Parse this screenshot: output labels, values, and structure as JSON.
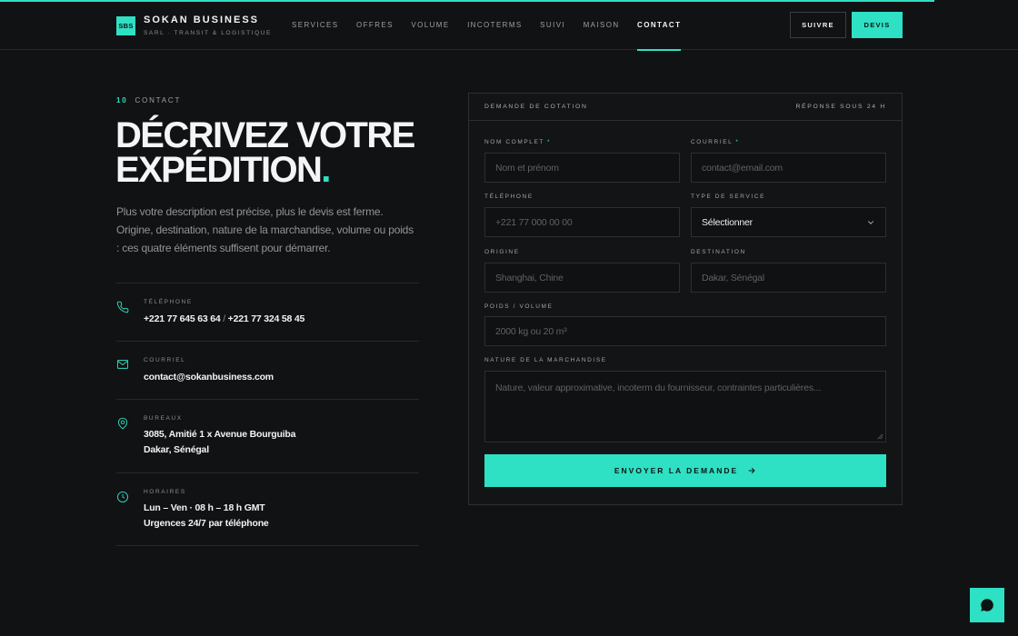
{
  "brand": {
    "logo": "SBS",
    "name": "SOKAN BUSINESS",
    "tagline": "SARL · TRANSIT & LOGISTIQUE"
  },
  "nav": [
    "SERVICES",
    "OFFRES",
    "VOLUME",
    "INCOTERMS",
    "SUIVI",
    "MAISON",
    "CONTACT"
  ],
  "nav_active": "CONTACT",
  "header_buttons": {
    "follow": "SUIVRE",
    "quote": "DEVIS"
  },
  "section": {
    "number": "10",
    "name": "CONTACT"
  },
  "headline": {
    "line1": "DÉCRIVEZ VOTRE",
    "line2": "EXPÉDITION",
    "dot": "."
  },
  "lead": "Plus votre description est précise, plus le devis est ferme. Origine, destination, nature de la marchandise, volume ou poids : ces quatre éléments suffisent pour démarrer.",
  "contact_info": {
    "phone": {
      "label": "TÉLÉPHONE",
      "value1": "+221 77 645 63 64",
      "separator": "/",
      "value2": "+221 77 324 58 45",
      "icon": "phone-icon"
    },
    "email": {
      "label": "COURRIEL",
      "value": "contact@sokanbusiness.com",
      "icon": "mail-icon"
    },
    "office": {
      "label": "BUREAUX",
      "line1": "3085, Amitié 1 x Avenue Bourguiba",
      "line2": "Dakar, Sénégal",
      "icon": "map-pin-icon"
    },
    "hours": {
      "label": "HORAIRES",
      "line1": "Lun – Ven · 08 h – 18 h GMT",
      "line2": "Urgences 24/7 par téléphone",
      "icon": "clock-icon"
    }
  },
  "form": {
    "title": "DEMANDE DE COTATION",
    "note": "RÉPONSE SOUS 24 H",
    "fields": {
      "name": {
        "label": "NOM COMPLET",
        "required": "*",
        "placeholder": "Nom et prénom"
      },
      "email": {
        "label": "COURRIEL",
        "required": "*",
        "placeholder": "contact@email.com"
      },
      "phone": {
        "label": "TÉLÉPHONE",
        "placeholder": "+221 77 000 00 00"
      },
      "service": {
        "label": "TYPE DE SERVICE",
        "value": "Sélectionner"
      },
      "origin": {
        "label": "ORIGINE",
        "placeholder": "Shanghai, Chine"
      },
      "destination": {
        "label": "DESTINATION",
        "placeholder": "Dakar, Sénégal"
      },
      "weight": {
        "label": "POIDS / VOLUME",
        "placeholder": "2000 kg ou 20 m³"
      },
      "nature": {
        "label": "NATURE DE LA MARCHANDISE",
        "placeholder": "Nature, valeur approximative, incoterm du fournisseur, contraintes particulières..."
      }
    },
    "submit": "ENVOYER LA DEMANDE"
  },
  "colors": {
    "accent": "#2ee0c4",
    "background": "#111213",
    "text": "#f2f3f4"
  }
}
